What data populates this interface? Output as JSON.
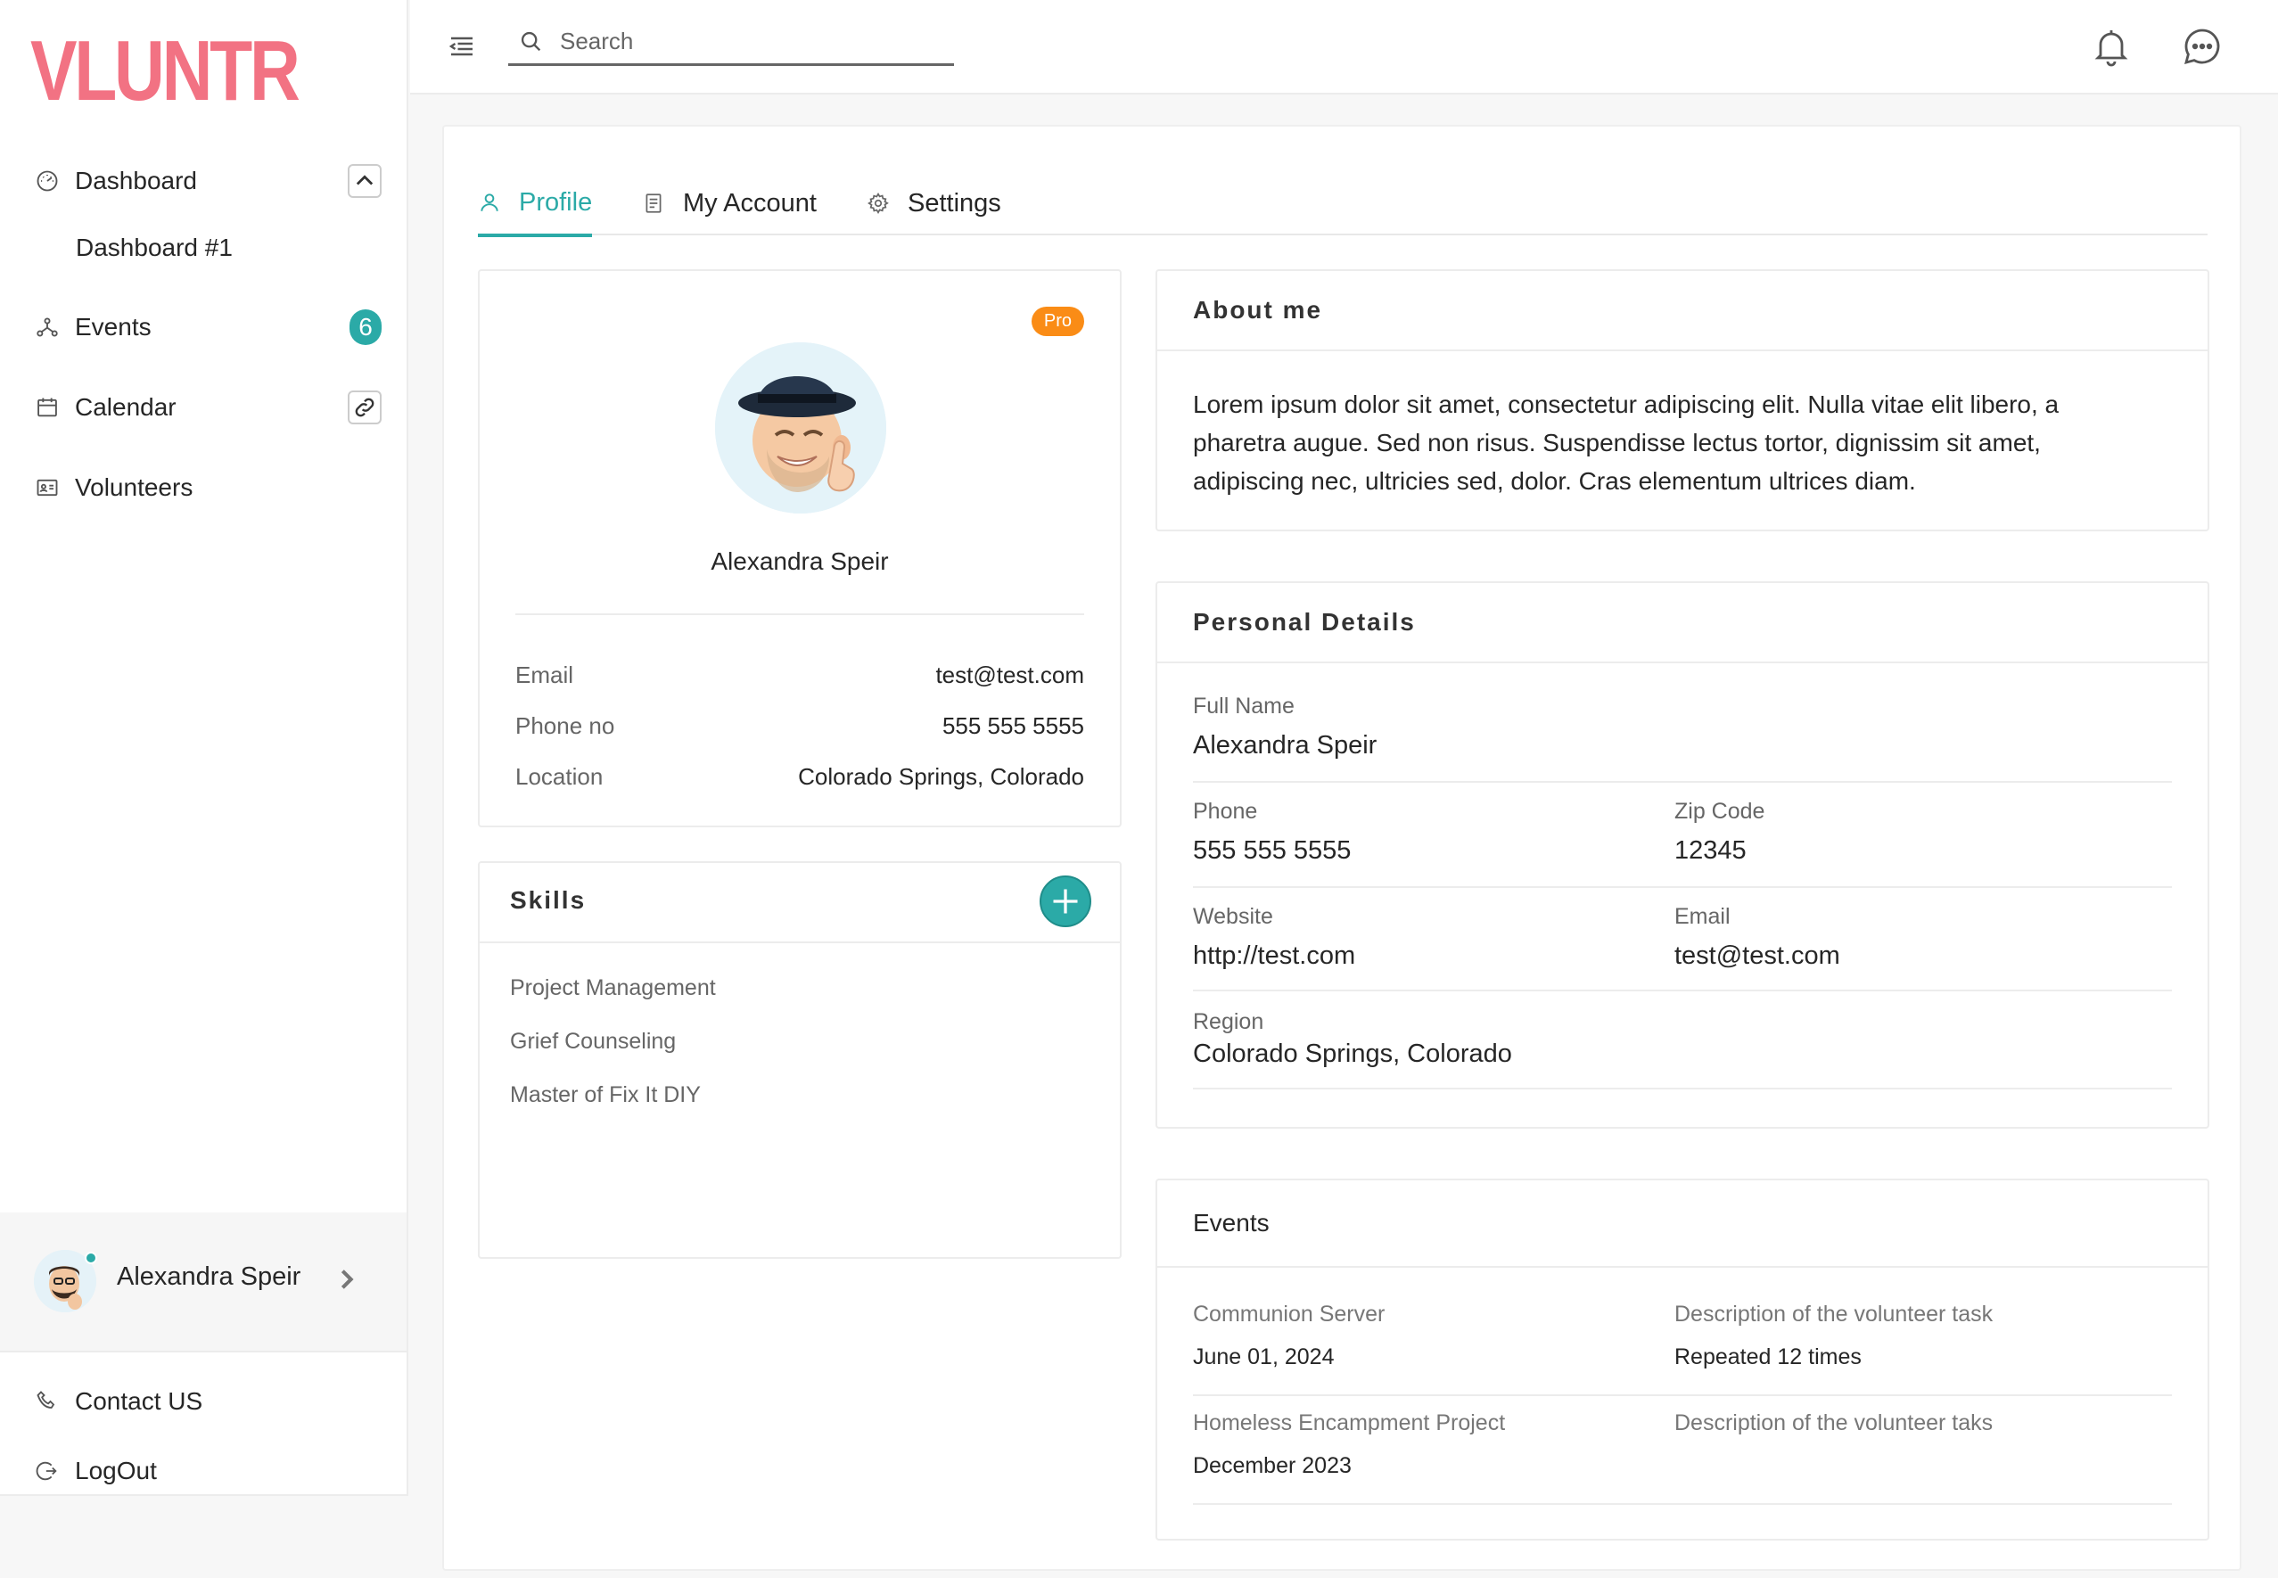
{
  "sidebar": {
    "logo": "VLUNTR",
    "nav": [
      {
        "label": "Dashboard",
        "icon": "dashboard-gauge-icon"
      },
      {
        "label": "Events",
        "icon": "network-nodes-icon",
        "badge": "6"
      },
      {
        "label": "Calendar",
        "icon": "calendar-icon"
      },
      {
        "label": "Volunteers",
        "icon": "id-card-icon"
      }
    ],
    "dashboard_sub": "Dashboard #1",
    "user": {
      "name": "Alexandra Speir"
    },
    "bottom": [
      {
        "label": "Contact US",
        "icon": "phone-icon"
      },
      {
        "label": "LogOut",
        "icon": "logout-icon"
      }
    ]
  },
  "topbar": {
    "search_placeholder": "Search"
  },
  "tabs": [
    {
      "label": "Profile",
      "icon": "user-icon",
      "active": true
    },
    {
      "label": "My Account",
      "icon": "document-icon",
      "active": false
    },
    {
      "label": "Settings",
      "icon": "gear-icon",
      "active": false
    }
  ],
  "profile_card": {
    "badge": "Pro",
    "name": "Alexandra Speir",
    "rows": [
      {
        "key": "Email",
        "value": "test@test.com"
      },
      {
        "key": "Phone no",
        "value": "555 555 5555"
      },
      {
        "key": "Location",
        "value": "Colorado Springs, Colorado"
      }
    ]
  },
  "skills": {
    "title": "Skills",
    "items": [
      "Project  Management",
      "Grief Counseling",
      "Master of Fix It DIY"
    ]
  },
  "about": {
    "title": "About me",
    "text": "Lorem ipsum dolor sit amet, consectetur adipiscing elit. Nulla vitae elit libero, a pharetra augue. Sed non risus. Suspendisse lectus tortor, dignissim sit amet, adipiscing nec, ultricies sed, dolor. Cras elementum ultrices diam."
  },
  "personal": {
    "title": "Personal Details",
    "full_name_label": "Full Name",
    "full_name": "Alexandra Speir",
    "phone_label": "Phone",
    "phone": "555 555 5555",
    "zip_label": "Zip Code",
    "zip": "12345",
    "website_label": "Website",
    "website": "http://test.com",
    "email_label": "Email",
    "email": "test@test.com",
    "region_label": "Region",
    "region": "Colorado Springs, Colorado"
  },
  "events": {
    "title": "Events",
    "items": [
      {
        "name": "Communion Server",
        "date": "June 01, 2024",
        "desc": "Description of the volunteer task",
        "detail": "Repeated 12 times"
      },
      {
        "name": "Homeless Encampment Project",
        "date": "December 2023",
        "desc": "Description of the volunteer taks",
        "detail": ""
      }
    ]
  },
  "colors": {
    "accent": "#2baaa7",
    "logo": "#f27283",
    "pro": "#fa8c16"
  }
}
